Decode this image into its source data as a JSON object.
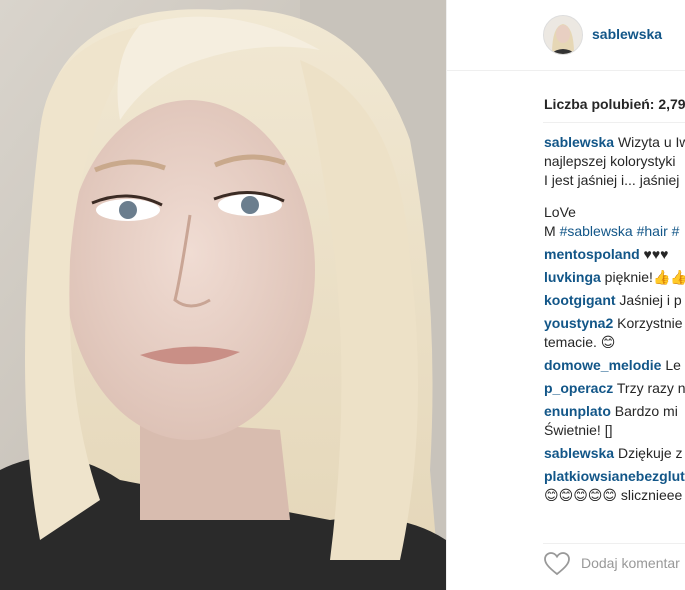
{
  "post": {
    "username": "sablewska",
    "likes_text": "Liczba polubień: 2,79",
    "caption_lines": [
      "Wizyta u Iw",
      "najlepszej kolorystyki",
      "I jest jaśniej i... jaśniej"
    ],
    "caption_love": "LoVe",
    "caption_sig_prefix": "M",
    "caption_tags": "#sablewska #hair #"
  },
  "comments": [
    {
      "user": "mentospoland",
      "text": " ♥♥♥"
    },
    {
      "user": "luvkinga",
      "text": " pięknie!👍👍"
    },
    {
      "user": "kootgigant",
      "text": " Jaśniej i p"
    },
    {
      "user": "youstyna2",
      "text": " Korzystnie",
      "cont": "temacie. 😊"
    },
    {
      "user": "domowe_melodie",
      "text": " Le"
    },
    {
      "user": "p_operacz",
      "text": " Trzy razy n"
    },
    {
      "user": "enunplato",
      "text": " Bardzo mi",
      "cont": "Świetnie! []"
    },
    {
      "user": "sablewska",
      "text": " Dziękuje z"
    },
    {
      "user": "platkiowsianebezglut",
      "text": "",
      "cont": "😊😊😊😊😊 slicznieee"
    }
  ],
  "footer": {
    "heart_icon": "heart-outline-icon",
    "add_comment_placeholder": "Dodaj komentar"
  }
}
